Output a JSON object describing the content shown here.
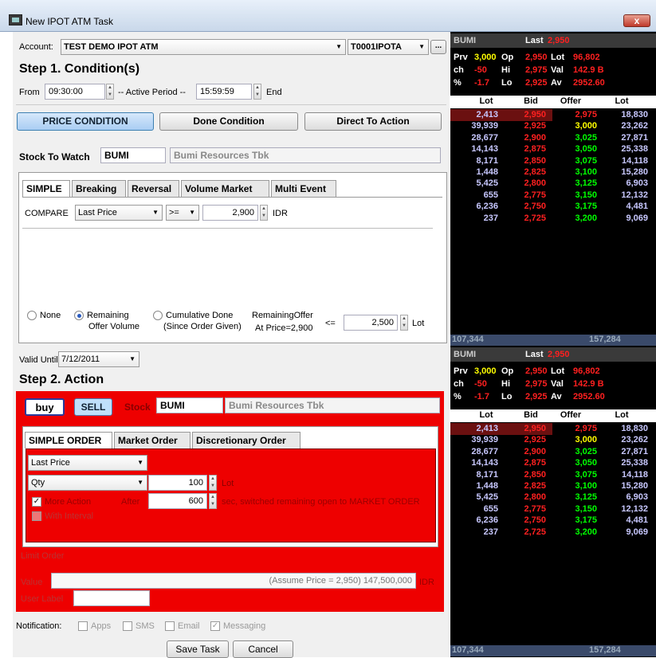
{
  "window": {
    "title": "New IPOT ATM Task",
    "close": "x"
  },
  "account": {
    "label": "Account:",
    "value": "TEST DEMO IPOT ATM",
    "code": "T0001IPOTA",
    "more": "..."
  },
  "step1": {
    "title": "Step 1. Condition(s)",
    "from_label": "From",
    "from_value": "09:30:00",
    "active_label": "-- Active Period --",
    "to_value": "15:59:59",
    "end_label": "End",
    "btn_price": "PRICE CONDITION",
    "btn_done": "Done Condition",
    "btn_direct": "Direct To Action",
    "stock_label": "Stock To Watch",
    "stock_code": "BUMI",
    "stock_name": "Bumi Resources Tbk",
    "tabs": [
      "SIMPLE",
      "Breaking",
      "Reversal",
      "Volume Market",
      "Multi Event"
    ],
    "compare_label": "COMPARE",
    "compare_field": "Last Price",
    "compare_op": ">=",
    "compare_value": "2,900",
    "compare_unit": "IDR",
    "opt_none": "None",
    "opt_remaining_1": "Remaining",
    "opt_remaining_2": "Offer Volume",
    "opt_cumulative_1": "Cumulative Done",
    "opt_cumulative_2": "(Since Order Given)",
    "remaining_1": "RemainingOffer",
    "remaining_2": "At Price=2,900",
    "lte": "<=",
    "lot_value": "2,500",
    "lot_label": "Lot",
    "valid_label": "Valid Until",
    "valid_value": "7/12/2011"
  },
  "step2": {
    "title": "Step 2. Action",
    "buy": "buy",
    "sell": "SELL",
    "stock_label": "Stock",
    "stock_code": "BUMI",
    "stock_name": "Bumi Resources Tbk",
    "tabs": [
      "SIMPLE ORDER",
      "Market Order",
      "Discretionary Order"
    ],
    "price_select": "Last Price",
    "qty_select": "Qty",
    "qty_value": "100",
    "qty_unit": "Lot",
    "more_action": "More Action",
    "after_label": "After",
    "after_value": "600",
    "after_text": "sec, switched remaining open to MARKET ORDER",
    "with_interval": "With Interval",
    "limit_order": "Limit Order",
    "value_label": "Value",
    "value_text": "(Assume Price = 2,950) 147,500,000",
    "value_unit": "IDR",
    "user_label": "User Label"
  },
  "notification": {
    "label": "Notification:",
    "apps": "Apps",
    "sms": "SMS",
    "email": "Email",
    "messaging": "Messaging"
  },
  "footer": {
    "save": "Save Task",
    "cancel": "Cancel"
  },
  "quote": {
    "code": "BUMI",
    "last_label": "Last",
    "last_value": "2,950",
    "rows": [
      {
        "a": "Prv",
        "b": "3,000",
        "c": "Op",
        "d": "2,950",
        "e": "Lot",
        "f": "96,802"
      },
      {
        "a": "ch",
        "b": "-50",
        "c": "Hi",
        "d": "2,975",
        "e": "Val",
        "f": "142.9 B"
      },
      {
        "a": "%",
        "b": "-1.7",
        "c": "Lo",
        "d": "2,925",
        "e": "Av",
        "f": "2952.60"
      }
    ],
    "headers": [
      "Lot",
      "Bid",
      "Offer",
      "Lot"
    ],
    "book": [
      [
        "2,413",
        "2,950",
        "2,975",
        "18,830"
      ],
      [
        "39,939",
        "2,925",
        "3,000",
        "23,262"
      ],
      [
        "28,677",
        "2,900",
        "3,025",
        "27,871"
      ],
      [
        "14,143",
        "2,875",
        "3,050",
        "25,338"
      ],
      [
        "8,171",
        "2,850",
        "3,075",
        "14,118"
      ],
      [
        "1,448",
        "2,825",
        "3,100",
        "15,280"
      ],
      [
        "5,425",
        "2,800",
        "3,125",
        "6,903"
      ],
      [
        "655",
        "2,775",
        "3,150",
        "12,132"
      ],
      [
        "6,236",
        "2,750",
        "3,175",
        "4,481"
      ],
      [
        "237",
        "2,725",
        "3,200",
        "9,069"
      ]
    ],
    "total_bid": "107,344",
    "total_offer": "157,284"
  },
  "colors": {
    "accent_red": "#ee0000",
    "bid_red": "#ff2020",
    "offer_green": "#00ff00",
    "lot_blue": "#c8c8ff"
  }
}
